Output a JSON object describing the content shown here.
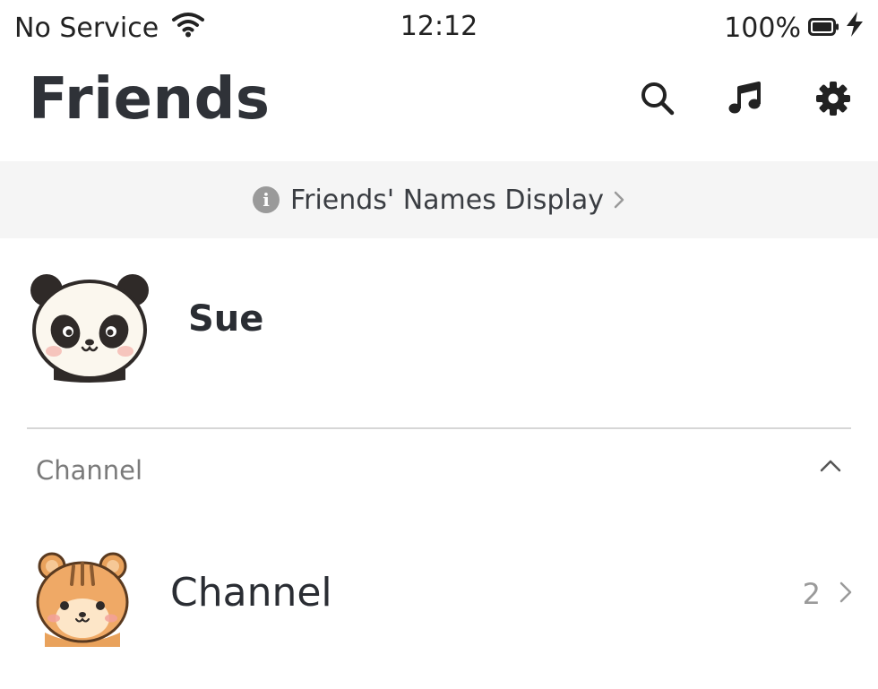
{
  "status_bar": {
    "carrier": "No Service",
    "time": "12:12",
    "battery": "100%"
  },
  "header": {
    "title": "Friends",
    "icons": [
      "search-icon",
      "music-note-icon",
      "gear-icon"
    ]
  },
  "banner": {
    "label": "Friends' Names Display",
    "icon": "info-icon",
    "info_glyph": "i"
  },
  "profile": {
    "name": "Sue",
    "avatar": "panda"
  },
  "sections": [
    {
      "title": "Channel",
      "expanded": true,
      "items": [
        {
          "name": "Channel",
          "count": "2",
          "avatar": "chipmunk"
        }
      ]
    }
  ],
  "colors": {
    "text_primary": "#2a2d33",
    "text_secondary": "#7a7a7a",
    "banner_bg": "#f5f5f5",
    "divider": "#d6d6d6"
  }
}
